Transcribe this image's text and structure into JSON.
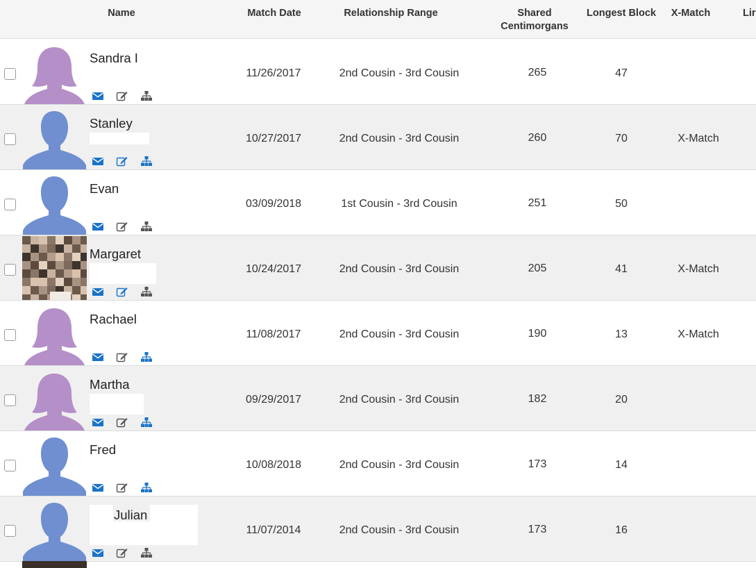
{
  "table": {
    "columns": {
      "name": "Name",
      "match_date": "Match Date",
      "relationship_range": "Relationship Range",
      "shared_cm_line1": "Shared",
      "shared_cm_line2": "Centimorgans",
      "longest_block": "Longest Block",
      "x_match": "X-Match",
      "linked": "Lir"
    },
    "rows": [
      {
        "first_name": "Sandra I",
        "avatar": "female-silhouette",
        "match_date": "11/26/2017",
        "relationship_range": "2nd Cousin - 3rd Cousin",
        "shared_cm": "265",
        "longest_block": "47",
        "x_match": "",
        "has_notes": false,
        "tree_linked": false
      },
      {
        "first_name": "Stanley",
        "avatar": "male-silhouette",
        "match_date": "10/27/2017",
        "relationship_range": "2nd Cousin - 3rd Cousin",
        "shared_cm": "260",
        "longest_block": "70",
        "x_match": "X-Match",
        "has_notes": true,
        "tree_linked": true
      },
      {
        "first_name": "Evan",
        "avatar": "male-silhouette",
        "match_date": "03/09/2018",
        "relationship_range": "1st Cousin - 3rd Cousin",
        "shared_cm": "251",
        "longest_block": "50",
        "x_match": "",
        "has_notes": false,
        "tree_linked": false
      },
      {
        "first_name": "Margaret",
        "avatar": "pixelated-photo",
        "match_date": "10/24/2017",
        "relationship_range": "2nd Cousin - 3rd Cousin",
        "shared_cm": "205",
        "longest_block": "41",
        "x_match": "X-Match",
        "has_notes": true,
        "tree_linked": false
      },
      {
        "first_name": "Rachael",
        "avatar": "female-silhouette",
        "match_date": "11/08/2017",
        "relationship_range": "2nd Cousin - 3rd Cousin",
        "shared_cm": "190",
        "longest_block": "13",
        "x_match": "X-Match",
        "has_notes": false,
        "tree_linked": true
      },
      {
        "first_name": "Martha",
        "avatar": "female-silhouette",
        "match_date": "09/29/2017",
        "relationship_range": "2nd Cousin - 3rd Cousin",
        "shared_cm": "182",
        "longest_block": "20",
        "x_match": "",
        "has_notes": false,
        "tree_linked": true
      },
      {
        "first_name": "Fred",
        "avatar": "male-silhouette",
        "match_date": "10/08/2018",
        "relationship_range": "2nd Cousin - 3rd Cousin",
        "shared_cm": "173",
        "longest_block": "14",
        "x_match": "",
        "has_notes": false,
        "tree_linked": true
      },
      {
        "first_name": "Julian",
        "avatar": "male-silhouette",
        "match_date": "11/07/2014",
        "relationship_range": "2nd Cousin - 3rd Cousin",
        "shared_cm": "173",
        "longest_block": "16",
        "x_match": "",
        "has_notes": false,
        "tree_linked": false
      }
    ]
  },
  "icons": {
    "message": "envelope-icon",
    "notes": "edit-notes-icon",
    "tree": "family-tree-icon"
  },
  "colors": {
    "link_blue": "#1a73c9",
    "icon_gray": "#555555",
    "female_avatar": "#b58fc8",
    "male_avatar": "#6f8fd0",
    "header_bg": "#f5f5f5",
    "alt_row_bg": "#f0f0f0"
  }
}
